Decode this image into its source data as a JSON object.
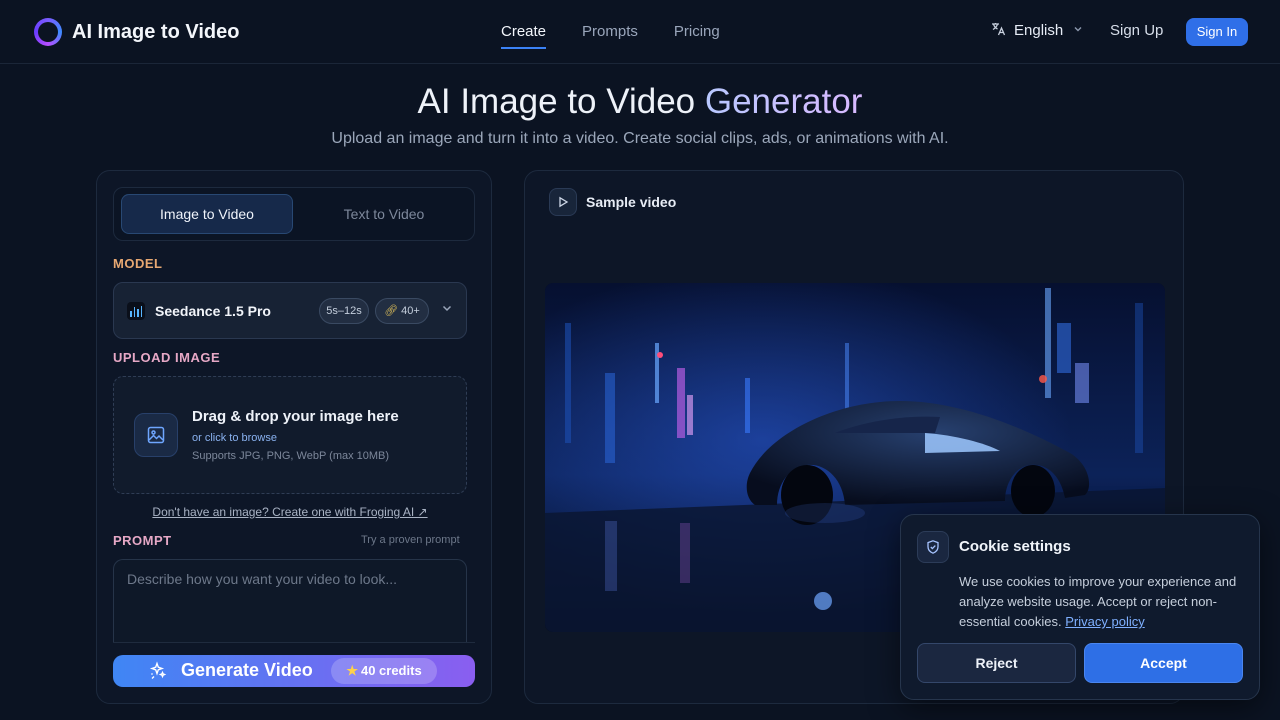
{
  "brand": {
    "name": "AI Image to Video"
  },
  "nav": {
    "links": [
      {
        "label": "Create",
        "active": true
      },
      {
        "label": "Prompts",
        "active": false
      },
      {
        "label": "Pricing",
        "active": false
      }
    ],
    "language": "English",
    "sign_up": "Sign Up",
    "sign_in": "Sign In"
  },
  "hero": {
    "title_main": "AI Image to Video",
    "title_accent": "Generator",
    "subtitle": "Upload an image and turn it into a video. Create social clips, ads, or animations with AI."
  },
  "generator": {
    "tabs": [
      {
        "label": "Image to Video",
        "active": true
      },
      {
        "label": "Text to Video",
        "active": false
      }
    ],
    "model_label": "MODEL",
    "model": {
      "name": "Seedance 1.5 Pro",
      "duration": "5s–12s",
      "credits": "40+"
    },
    "upload_label": "UPLOAD IMAGE",
    "upload": {
      "title": "Drag & drop your image here",
      "browse": "or click to browse",
      "hint": "Supports JPG, PNG, WebP (max 10MB)"
    },
    "create_link": "Don't have an image? Create one with Froging AI ↗",
    "prompt_label": "PROMPT",
    "prompt_hint": "Try a proven prompt",
    "prompt_placeholder": "Describe how you want your video to look...",
    "generate_label": "Generate Video",
    "generate_credits": "40 credits"
  },
  "preview": {
    "label": "Sample video"
  },
  "cookie": {
    "title": "Cookie settings",
    "text": "We use cookies to improve your experience and analyze website usage. Accept or reject non-essential cookies.",
    "policy_link": "Privacy policy",
    "reject": "Reject",
    "accept": "Accept"
  },
  "colors": {
    "background": "#0b1322",
    "accent_blue": "#2f6fe8",
    "model_label": "#e7a872",
    "section_label": "#e6a8c6"
  }
}
